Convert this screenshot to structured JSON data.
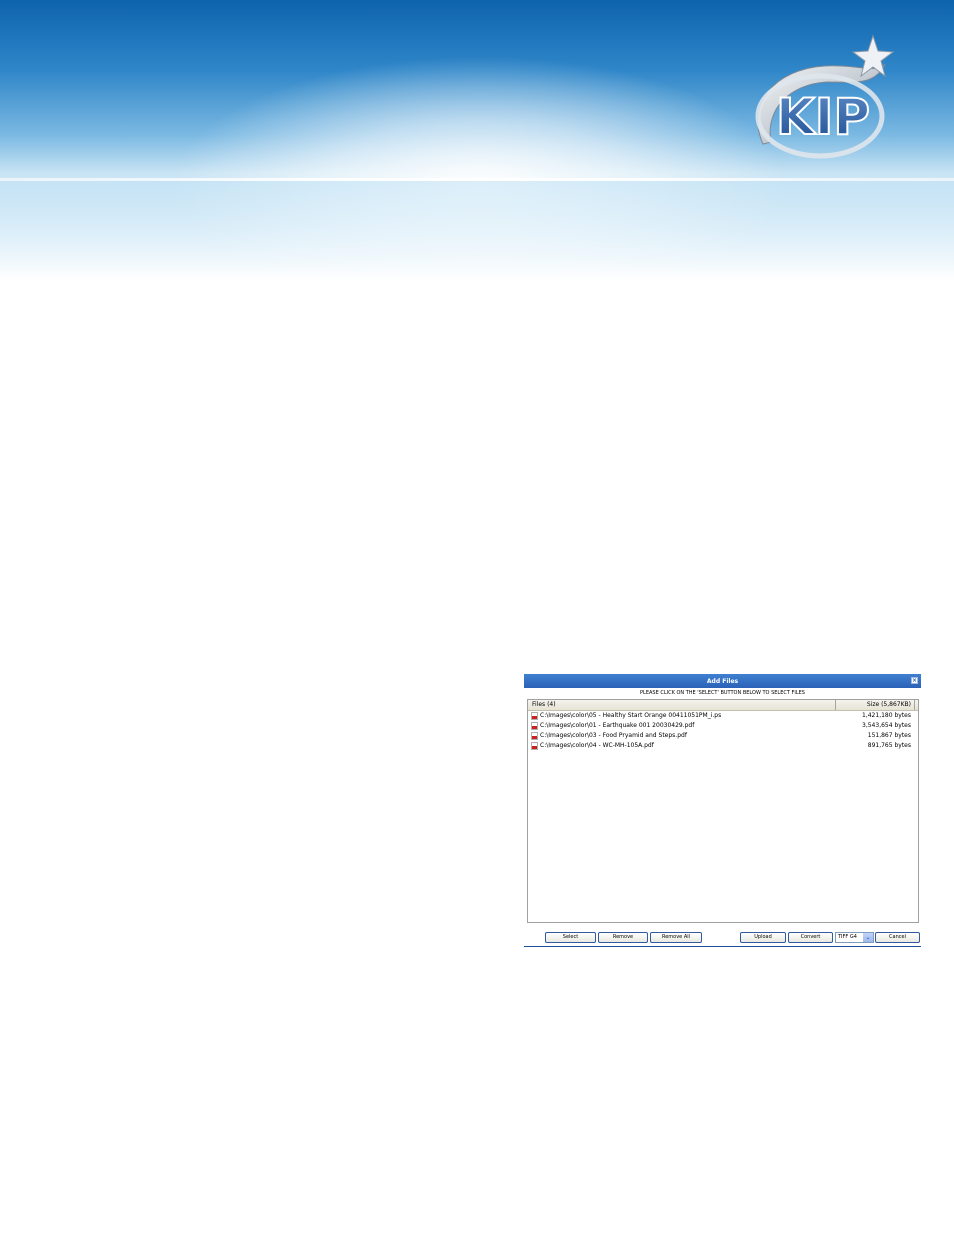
{
  "brand": {
    "logo_text": "KIP"
  },
  "dialog": {
    "title": "Add Files",
    "close_glyph": "×",
    "instruction": "PLEASE CLICK ON THE 'SELECT' BUTTON BELOW TO SELECT FILES",
    "columns": {
      "files": "Files (4)",
      "size": "Size (5,867KB)"
    },
    "files": [
      {
        "name": "C:\\Images\\color\\05 - Healthy Start Orange 00411051PM_i.ps",
        "size": "1,421,180 bytes"
      },
      {
        "name": "C:\\Images\\color\\01 - Earthquake 001 20030429.pdf",
        "size": "3,543,654 bytes"
      },
      {
        "name": "C:\\Images\\color\\03 - Food Pryamid and Steps.pdf",
        "size": "151,867 bytes"
      },
      {
        "name": "C:\\Images\\color\\04 - WC-MH-105A.pdf",
        "size": "891,765 bytes"
      }
    ],
    "buttons": {
      "select": "Select",
      "remove": "Remove",
      "remove_all": "Remove All",
      "upload": "Upload",
      "convert": "Convert",
      "cancel": "Cancel"
    },
    "format_select": {
      "value": "TIFF G4"
    }
  },
  "colors": {
    "title_bar": "#2a62b8",
    "banner_top": "#0e63ad",
    "button_border": "#335a9e"
  },
  "icons": [
    "kip-logo-icon",
    "close-icon",
    "pdf-file-icon",
    "ps-file-icon",
    "dropdown-arrow-icon"
  ]
}
